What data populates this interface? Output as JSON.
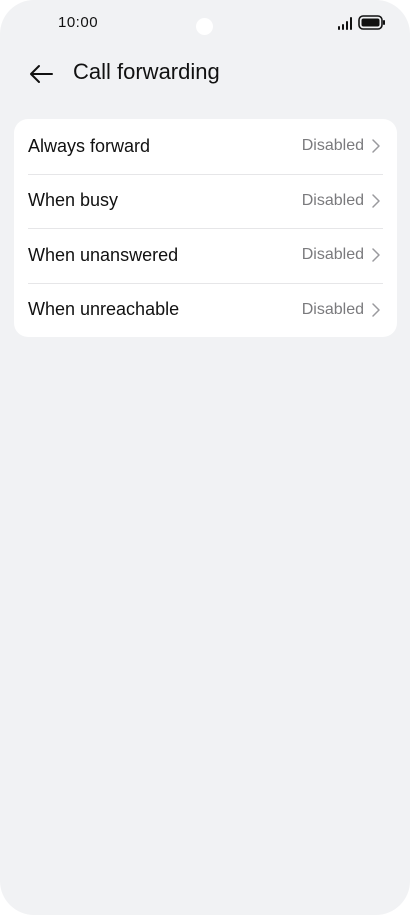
{
  "status_bar": {
    "time": "10:00",
    "icons": [
      "signal-icon",
      "battery-icon"
    ]
  },
  "header": {
    "back_icon": "arrow-left-icon",
    "title": "Call forwarding"
  },
  "forwarding_options": [
    {
      "label": "Always forward",
      "value": "Disabled"
    },
    {
      "label": "When busy",
      "value": "Disabled"
    },
    {
      "label": "When unanswered",
      "value": "Disabled"
    },
    {
      "label": "When unreachable",
      "value": "Disabled"
    }
  ],
  "colors": {
    "background": "#f1f2f4",
    "card": "#ffffff",
    "text_primary": "#111111",
    "text_secondary": "#7a7a7d",
    "divider": "#e6e6e8"
  }
}
